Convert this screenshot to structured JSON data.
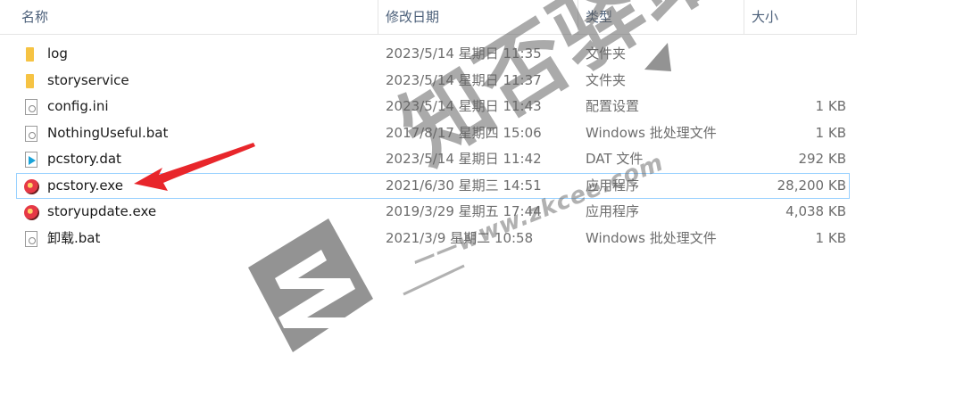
{
  "header": {
    "name": "名称",
    "date": "修改日期",
    "type": "类型",
    "size": "大小",
    "sort_indicator": "^"
  },
  "files": [
    {
      "name": "log",
      "date": "2023/5/14 星期日 11:35",
      "type": "文件夹",
      "size": "",
      "icon": "folder-icon"
    },
    {
      "name": "storyservice",
      "date": "2023/5/14 星期日 11:37",
      "type": "文件夹",
      "size": "",
      "icon": "folder-icon"
    },
    {
      "name": "config.ini",
      "date": "2023/5/14 星期日 11:43",
      "type": "配置设置",
      "size": "1 KB",
      "icon": "config-file-icon"
    },
    {
      "name": "NothingUseful.bat",
      "date": "2017/8/17 星期四 15:06",
      "type": "Windows 批处理文件",
      "size": "1 KB",
      "icon": "batch-file-icon"
    },
    {
      "name": "pcstory.dat",
      "date": "2023/5/14 星期日 11:42",
      "type": "DAT 文件",
      "size": "292 KB",
      "icon": "media-file-icon"
    },
    {
      "name": "pcstory.exe",
      "date": "2021/6/30 星期三 14:51",
      "type": "应用程序",
      "size": "28,200 KB",
      "icon": "app-icon"
    },
    {
      "name": "storyupdate.exe",
      "date": "2019/3/29 星期五 17:44",
      "type": "应用程序",
      "size": "4,038 KB",
      "icon": "app-icon"
    },
    {
      "name": "卸载.bat",
      "date": "2021/3/9 星期二 10:58",
      "type": "Windows 批处理文件",
      "size": "1 KB",
      "icon": "batch-file-icon"
    }
  ],
  "selected_row": 5,
  "watermark": {
    "title": "知否驿站",
    "url": "——www.zkcee.com"
  },
  "colors": {
    "header_text": "#4c607a",
    "selection_border": "#99d1ff",
    "annotation_arrow": "#e8262b",
    "folder": "#f6c343"
  }
}
